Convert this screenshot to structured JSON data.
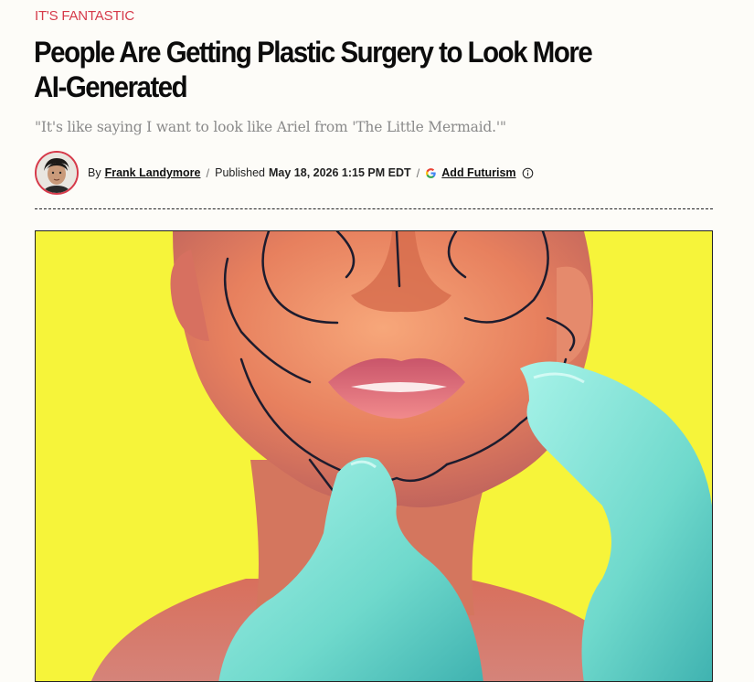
{
  "article": {
    "kicker": "IT'S FANTASTIC",
    "headline": "People Are Getting Plastic Surgery to Look More AI-Generated",
    "dek": "\"It's like saying I want to look like Ariel from 'The Little Mermaid.'\""
  },
  "byline": {
    "by_prefix": "By",
    "author": "Frank Landymore",
    "published_label": "Published",
    "published_date": "May 18, 2026 1:15 PM EDT",
    "add_source_label": "Add Futurism"
  },
  "icons": {
    "google": "google-g-icon",
    "info": "info-circle-icon",
    "avatar": "author-avatar"
  },
  "colors": {
    "kicker": "#d63a4a",
    "hero_background": "#f7f63a",
    "glove": "#7fe3d6"
  }
}
